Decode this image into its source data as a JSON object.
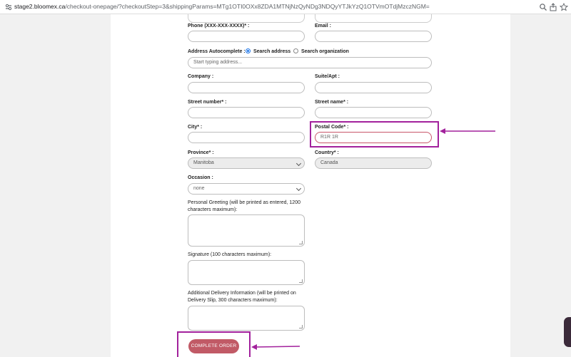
{
  "browser": {
    "url_host": "stage2.bloomex.ca",
    "url_path": "/checkout-onepage/?checkoutStep=3&shippingParams=MTg1OTI0OXx8ZDA1MTNjNzQyNDg3NDQyYTJkYzQ1OTVmOTdjMzczNGM="
  },
  "form": {
    "phone_label": "Phone (XXX-XXX-XXXX)* :",
    "email_label": "Email :",
    "address_auto_label": "Address Autocomplete :",
    "radio_search_address": "Search address",
    "radio_search_org": "Search organization",
    "address_placeholder": "Start typing address...",
    "company_label": "Company :",
    "suite_label": "Suite/Apt :",
    "street_number_label": "Street number* :",
    "street_name_label": "Street name* :",
    "city_label": "City* :",
    "postal_code_label": "Postal Code* :",
    "postal_code_value": "R1R 1R",
    "province_label": "Province* :",
    "province_value": "Manitoba",
    "country_label": "Country* :",
    "country_value": "Canada",
    "occasion_label": "Occasion :",
    "occasion_value": "none",
    "greeting_label_1": "Personal Greeting (will be printed as entered, 1200",
    "greeting_label_2": "characters maximum):",
    "signature_label": "Signature (100 characters maximum):",
    "delivery_label_1": "Additional Delivery Information (will be printed on",
    "delivery_label_2": "Delivery Slip, 300 characters maximum):",
    "complete_button": "COMPLETE ORDER"
  },
  "colors": {
    "highlight": "#a2219c",
    "button": "#c15a66",
    "radio_selected": "#1a73e8"
  },
  "icons": [
    "tune-icon",
    "zoom-icon",
    "share-icon",
    "star-icon",
    "arrow-icon"
  ]
}
